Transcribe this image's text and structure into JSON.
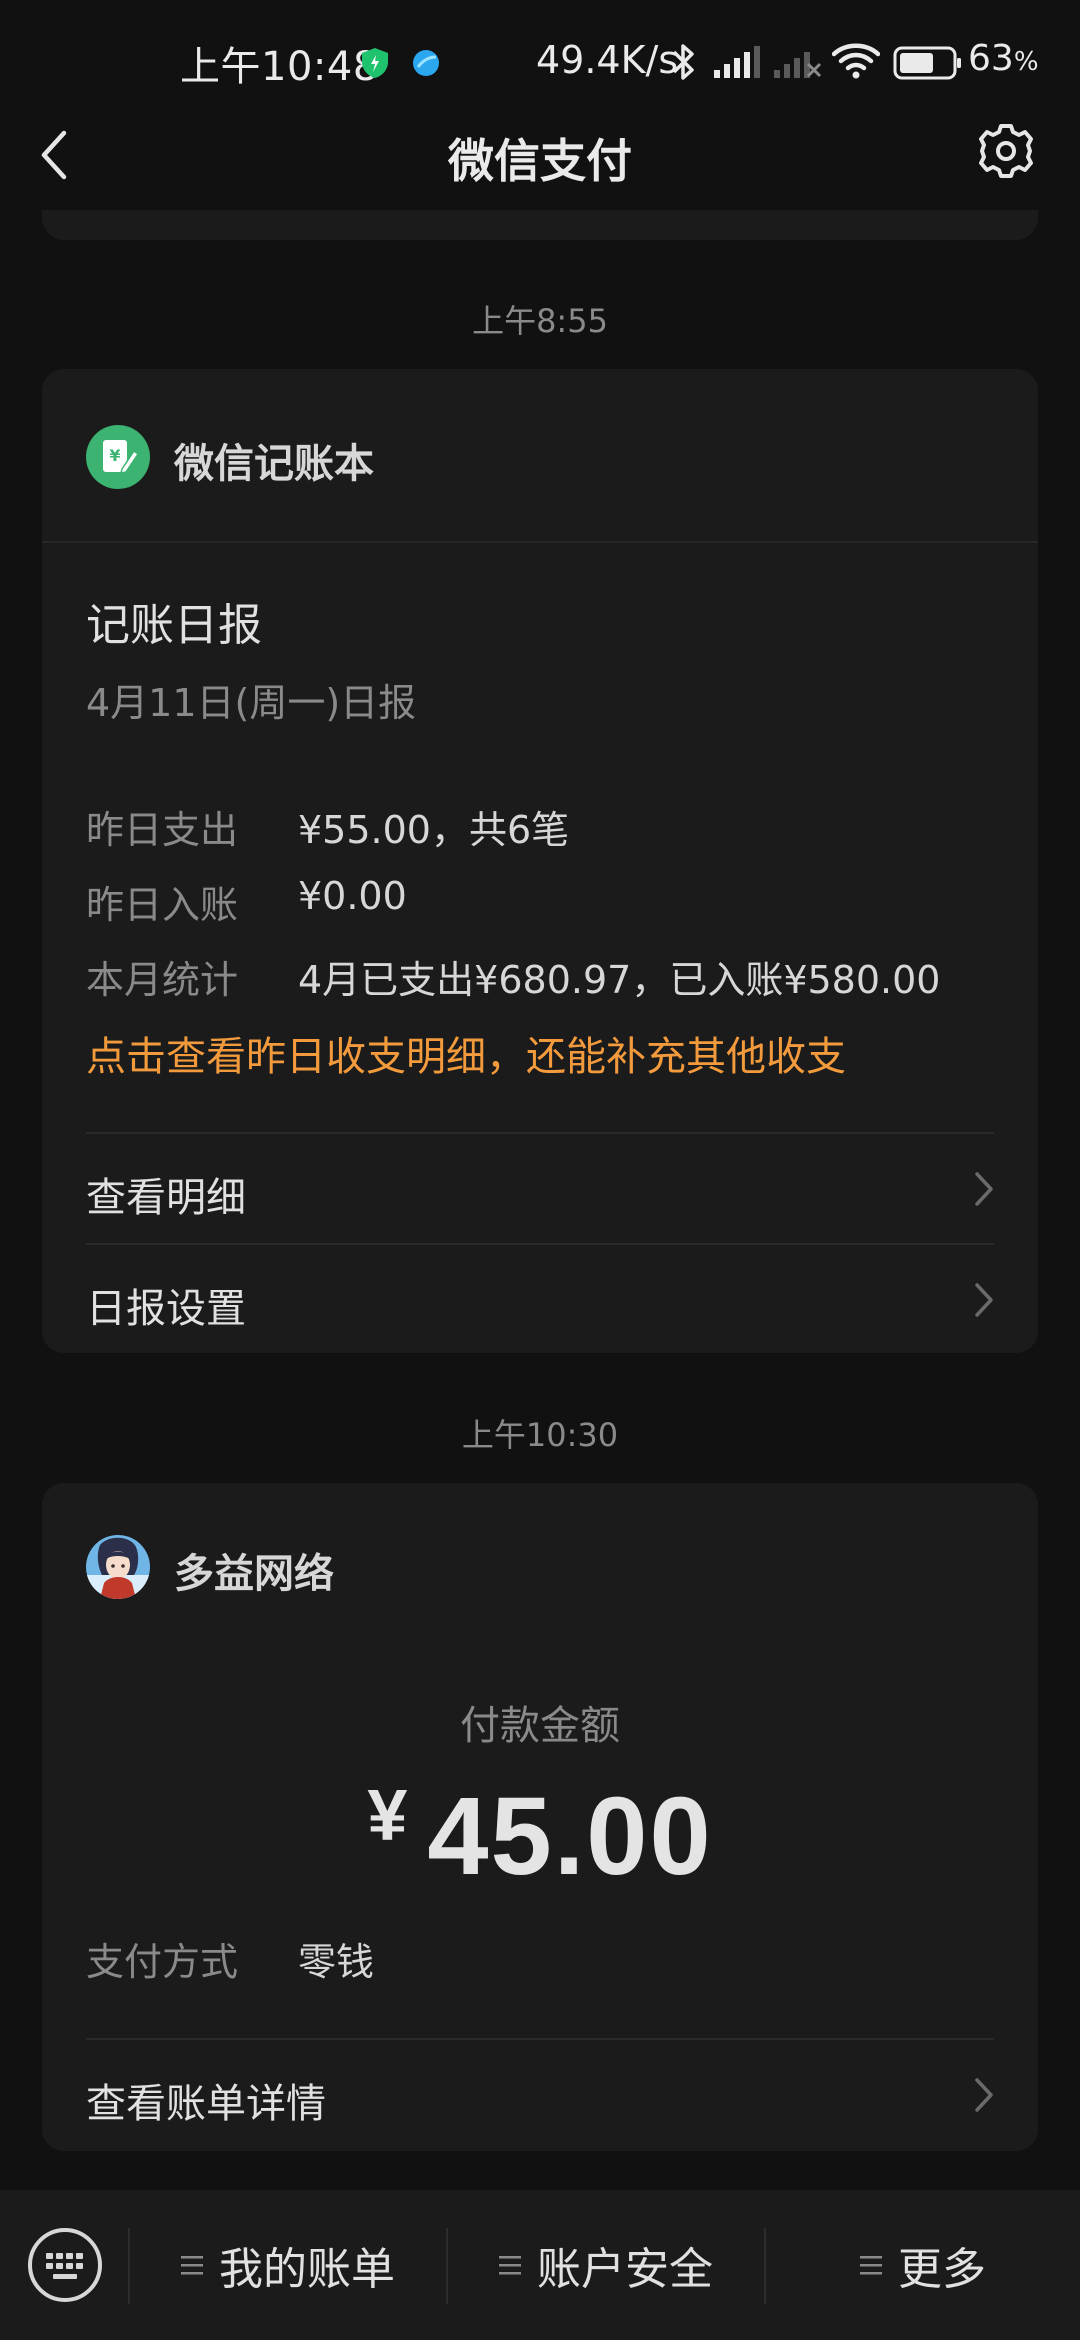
{
  "status_bar": {
    "time": "上午10:48",
    "net_speed": "49.4K/s",
    "battery": "63",
    "battery_unit": "%",
    "icons": [
      "shield-icon",
      "app-dot-icon",
      "bluetooth-icon",
      "signal-icon",
      "signal-off-icon",
      "wifi-icon",
      "battery-icon"
    ]
  },
  "nav": {
    "title": "微信支付",
    "back_icon": "back-arrow-icon",
    "settings_icon": "gear-icon"
  },
  "messages": [
    {
      "timestamp": "上午8:55",
      "sender": "微信记账本",
      "sender_icon": "ledger-book-icon",
      "title": "记账日报",
      "subtitle": "4月11日(周一)日报",
      "rows": [
        {
          "label": "昨日支出",
          "value": "¥55.00，共6笔"
        },
        {
          "label": "昨日入账",
          "value": "¥0.00"
        },
        {
          "label": "本月统计",
          "value": "4月已支出¥680.97，已入账¥580.00"
        }
      ],
      "note": "点击查看昨日收支明细，还能补充其他收支",
      "links": [
        "查看明细",
        "日报设置"
      ]
    },
    {
      "timestamp": "上午10:30",
      "sender": "多益网络",
      "amount_label": "付款金额",
      "currency": "¥",
      "amount": "45.00",
      "pay_method_label": "支付方式",
      "pay_method_value": "零钱",
      "link": "查看账单详情"
    }
  ],
  "bottom_menu": {
    "keyboard_icon": "keyboard-icon",
    "items": [
      "我的账单",
      "账户安全",
      "更多"
    ]
  },
  "colors": {
    "background": "#111111",
    "card": "#1b1b1b",
    "accent_orange": "#f39b3c",
    "wechat_green": "#3cb371"
  }
}
